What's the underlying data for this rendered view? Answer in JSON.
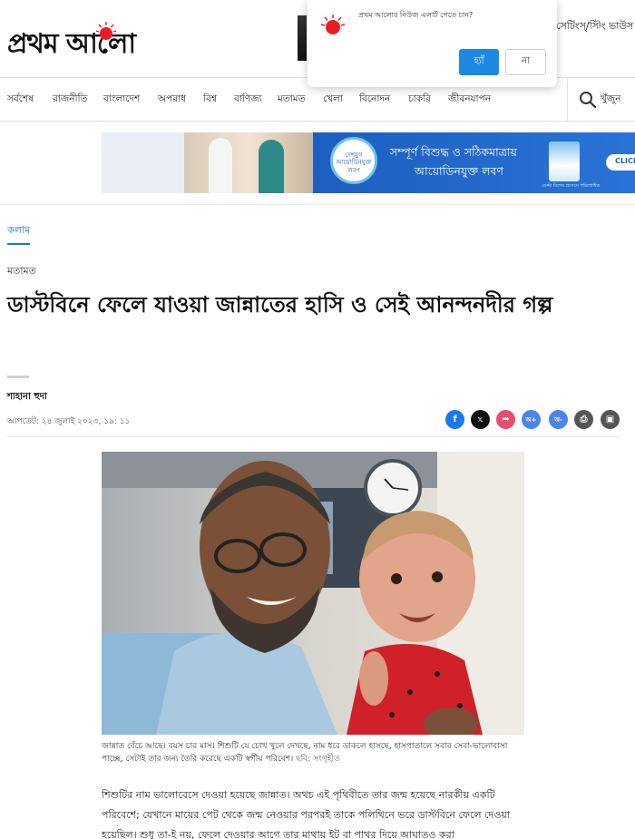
{
  "brand": {
    "logo_text": "প্রথম আলো",
    "accent": "#ed1c24"
  },
  "header": {
    "right_link": "সেটিংস্/স্টিং ভাউস"
  },
  "notification": {
    "message": "প্রথম আলোর নিউজ এলার্ট পেতে চান?",
    "yes_label": "হ্যাঁ",
    "no_label": "না"
  },
  "nav": {
    "items": [
      "সর্বশেষ",
      "রাজনীতি",
      "বাংলাদেশ",
      "অপরাধ",
      "বিশ্ব",
      "বাণিজ্য",
      "মতামত",
      "খেলা",
      "বিনোদন",
      "চাকরি",
      "জীবনযাপন"
    ],
    "search_label": "খুঁজুন"
  },
  "ad": {
    "badge_text": "দেশযুগ আয়োডিনযুক্ত লবণ",
    "line1": "সম্পূর্ণ বিশুদ্ধ ও সঠিকমাত্রায়",
    "line2": "আয়োডিনযুক্ত লবণ",
    "pack_caption": "ডেল্টা বিশেষ প্রসেসে পরিশোধিত",
    "cta": "CLICK H"
  },
  "article": {
    "section_tag": "কলাম",
    "category": "মতামত",
    "headline": "ডাস্টবিনে ফেলে যাওয়া জান্নাতের হাসি ও সেই আনন্দনদীর গল্প",
    "author": "শাহানা হুদা",
    "updated": "আপডেট: ২৪ জুলাই ২০২৩, ১৯: ১১",
    "share_buttons": [
      {
        "icon": "facebook-icon",
        "glyph": "f",
        "color": "#1877f2"
      },
      {
        "icon": "x-twitter-icon",
        "glyph": "𝕏",
        "color": "#111111"
      },
      {
        "icon": "share-icon",
        "glyph": "➦",
        "color": "#ea4c6e"
      },
      {
        "icon": "font-increase-icon",
        "glyph": "অ+",
        "color": "#4a86e8"
      },
      {
        "icon": "font-decrease-icon",
        "glyph": "অ-",
        "color": "#4a86e8"
      },
      {
        "icon": "print-icon",
        "glyph": "⎙",
        "color": "#555555"
      },
      {
        "icon": "bookmark-icon",
        "glyph": "▣",
        "color": "#555555"
      }
    ],
    "caption": "জান্নাত বেঁচে আছে। বয়স চার মাস। শিশুটি যে চোখ খুলে দেখছে, নাম ধরে ডাকলে হাসছে, হাসপাতালে সবার সেবা-ভালোবাসা পাচ্ছে, সেটাই তার জন্য তৈরি করেছে একটি স্বর্গীয় পরিবেশ।",
    "photo_credit": "ছবি: সংগৃহীত",
    "body": "শিশুটির নাম ভালোবেসে দেওয়া হয়েছে জান্নাত। অথচ এই পৃথিবীতে তার জন্ম হয়েছে নারকীয় একটি পরিবেশে; যেখানে মায়ের পেট থেকে জন্ম নেওয়ার পরপরই তাকে পলিথিনে ভরে ডাস্টবিনে ফেলে দেওয়া হয়েছিল। শুধু তা-ই নয়, ফেলে দেওয়ার আগে তার মাথায় ইট বা পাথর দিয়ে আঘাতও করা"
  }
}
